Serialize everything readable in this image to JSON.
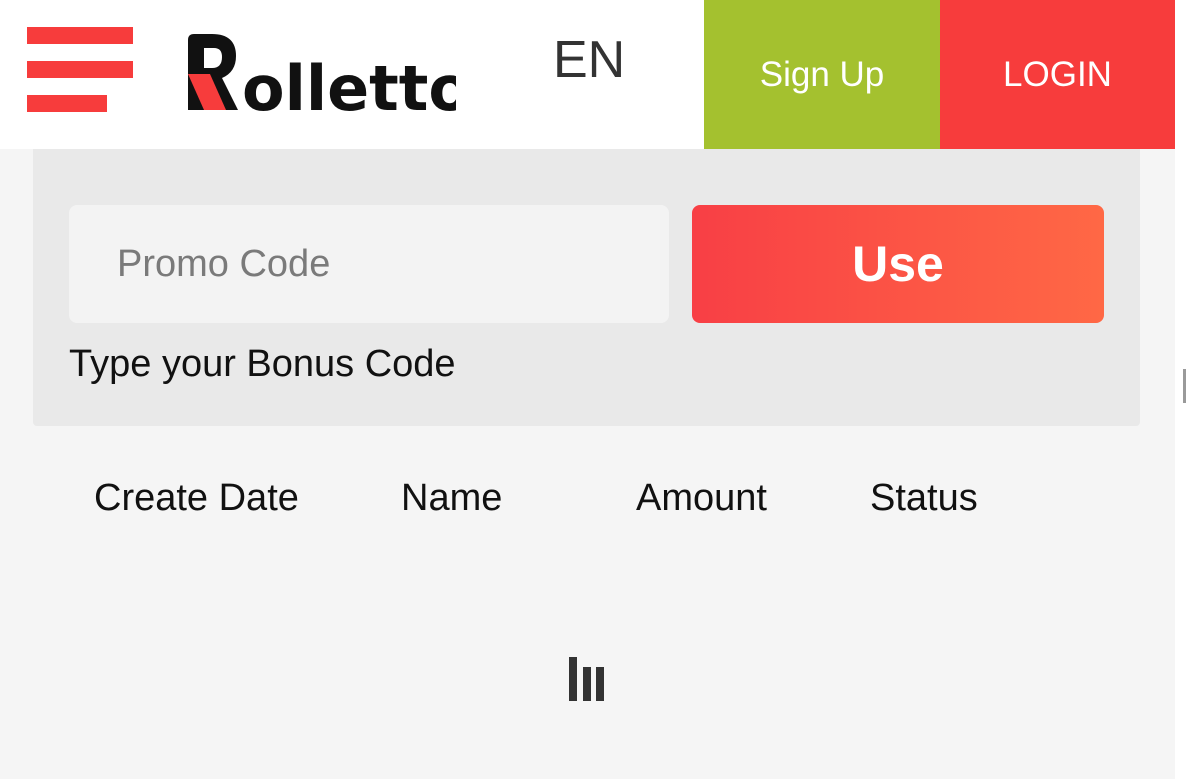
{
  "header": {
    "menu_icon": "hamburger-icon",
    "logo_text": "Rolletto",
    "language": "EN",
    "signup_label": "Sign Up",
    "login_label": "LOGIN",
    "colors": {
      "accent_red": "#f73c3c",
      "signup_green": "#a4c12f"
    }
  },
  "promo": {
    "placeholder": "Promo Code",
    "value": "",
    "use_label": "Use",
    "hint": "Type your Bonus Code"
  },
  "table": {
    "columns": [
      "Create Date",
      "Name",
      "Amount",
      "Status"
    ],
    "rows": []
  },
  "loader": {
    "icon": "loading-bars-icon"
  }
}
